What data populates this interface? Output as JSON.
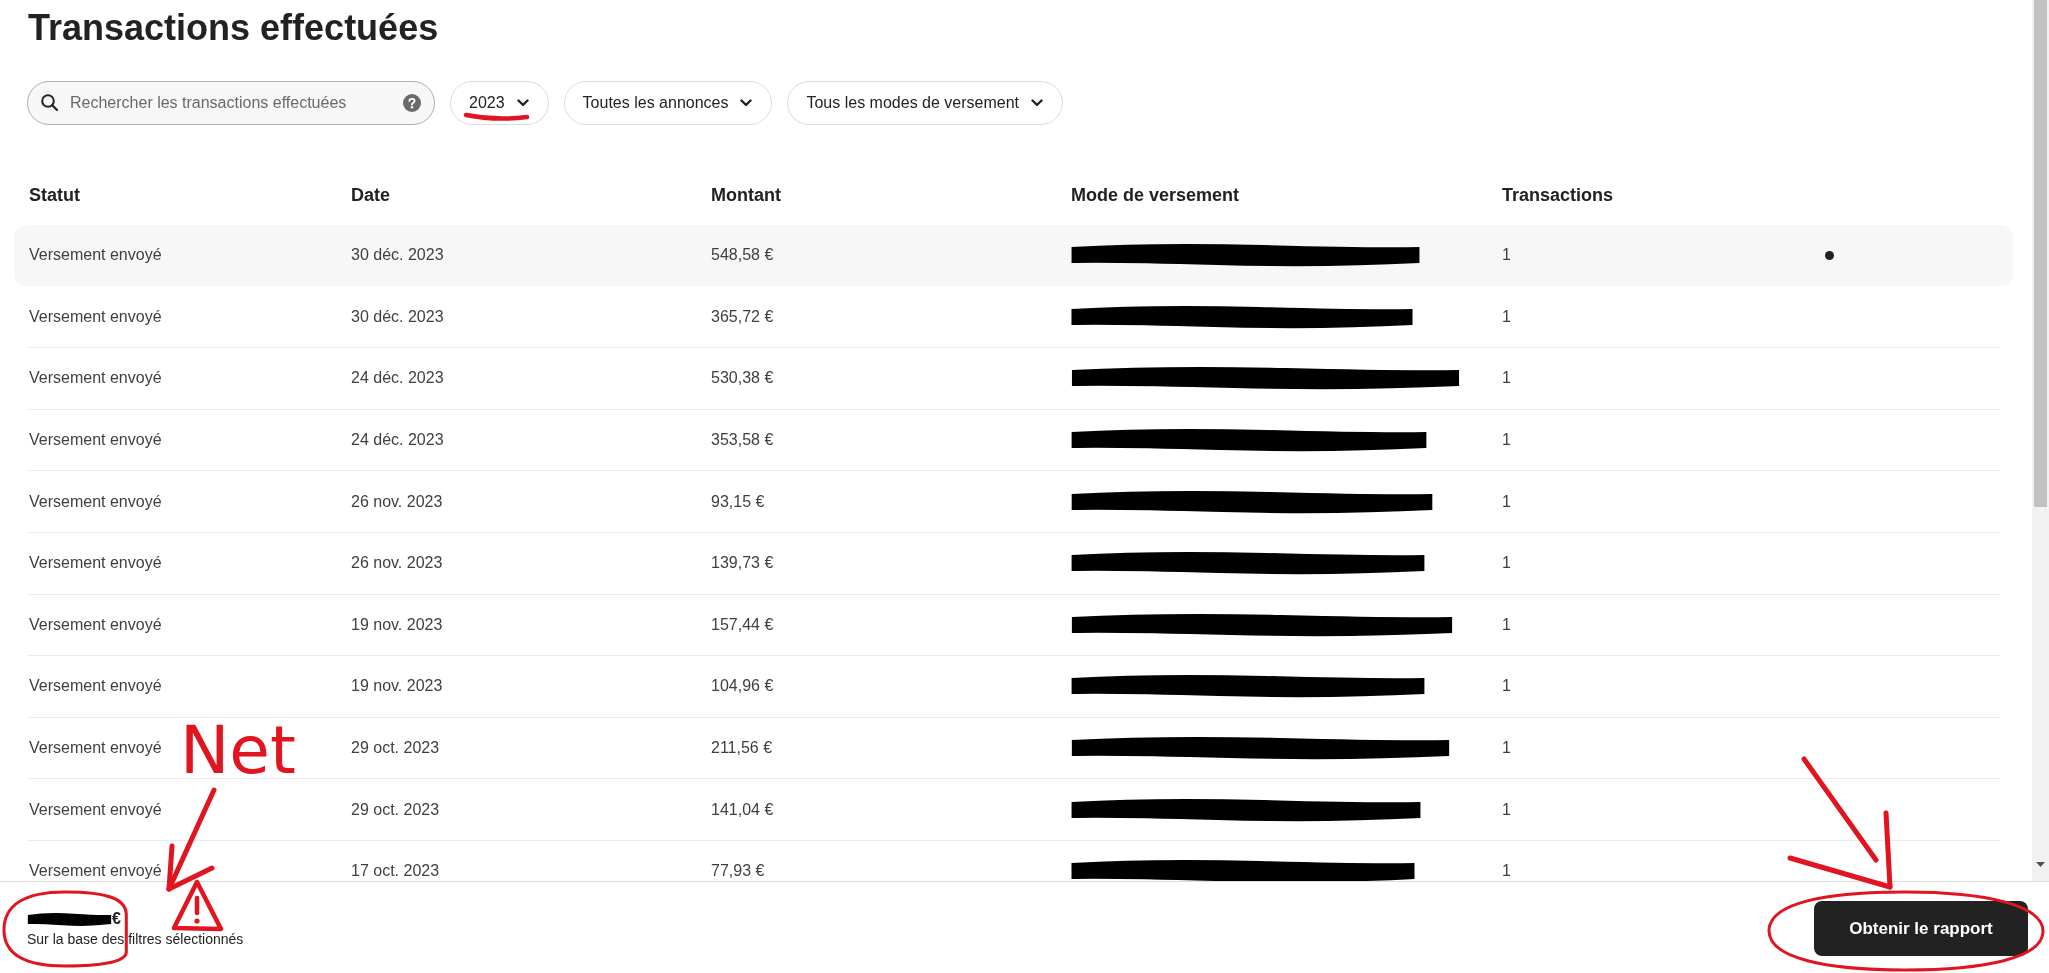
{
  "page": {
    "title": "Transactions effectuées"
  },
  "search": {
    "placeholder": "Rechercher les transactions effectuées"
  },
  "filters": [
    {
      "label": "2023"
    },
    {
      "label": "Toutes les annonces"
    },
    {
      "label": "Tous les modes de versement"
    }
  ],
  "table": {
    "columns": [
      "Statut",
      "Date",
      "Montant",
      "Mode de versement",
      "Transactions"
    ],
    "rows": [
      {
        "status": "Versement envoyé",
        "date": "30 déc. 2023",
        "amount": "548,58 €",
        "payout_method_redacted": true,
        "transactions": "1",
        "highlighted": true
      },
      {
        "status": "Versement envoyé",
        "date": "30 déc. 2023",
        "amount": "365,72 €",
        "payout_method_redacted": true,
        "transactions": "1",
        "highlighted": false
      },
      {
        "status": "Versement envoyé",
        "date": "24 déc. 2023",
        "amount": "530,38 €",
        "payout_method_redacted": true,
        "transactions": "1",
        "highlighted": false
      },
      {
        "status": "Versement envoyé",
        "date": "24 déc. 2023",
        "amount": "353,58 €",
        "payout_method_redacted": true,
        "transactions": "1",
        "highlighted": false
      },
      {
        "status": "Versement envoyé",
        "date": "26 nov. 2023",
        "amount": "93,15 €",
        "payout_method_redacted": true,
        "transactions": "1",
        "highlighted": false
      },
      {
        "status": "Versement envoyé",
        "date": "26 nov. 2023",
        "amount": "139,73 €",
        "payout_method_redacted": true,
        "transactions": "1",
        "highlighted": false
      },
      {
        "status": "Versement envoyé",
        "date": "19 nov. 2023",
        "amount": "157,44 €",
        "payout_method_redacted": true,
        "transactions": "1",
        "highlighted": false
      },
      {
        "status": "Versement envoyé",
        "date": "19 nov. 2023",
        "amount": "104,96 €",
        "payout_method_redacted": true,
        "transactions": "1",
        "highlighted": false
      },
      {
        "status": "Versement envoyé",
        "date": "29 oct. 2023",
        "amount": "211,56 €",
        "payout_method_redacted": true,
        "transactions": "1",
        "highlighted": false
      },
      {
        "status": "Versement envoyé",
        "date": "29 oct. 2023",
        "amount": "141,04 €",
        "payout_method_redacted": true,
        "transactions": "1",
        "highlighted": false
      },
      {
        "status": "Versement envoyé",
        "date": "17 oct. 2023",
        "amount": "77,93 €",
        "payout_method_redacted": true,
        "transactions": "1",
        "highlighted": false
      }
    ]
  },
  "footer": {
    "total_redacted": true,
    "currency": "€",
    "caption": "Sur la base des filtres sélectionnés",
    "button": "Obtenir le rapport"
  },
  "annotations": {
    "year_underline": true,
    "note": "Net",
    "note_arrow": true,
    "total_circle": true,
    "warning_sign": true,
    "report_arrow": true,
    "report_circle": true
  }
}
